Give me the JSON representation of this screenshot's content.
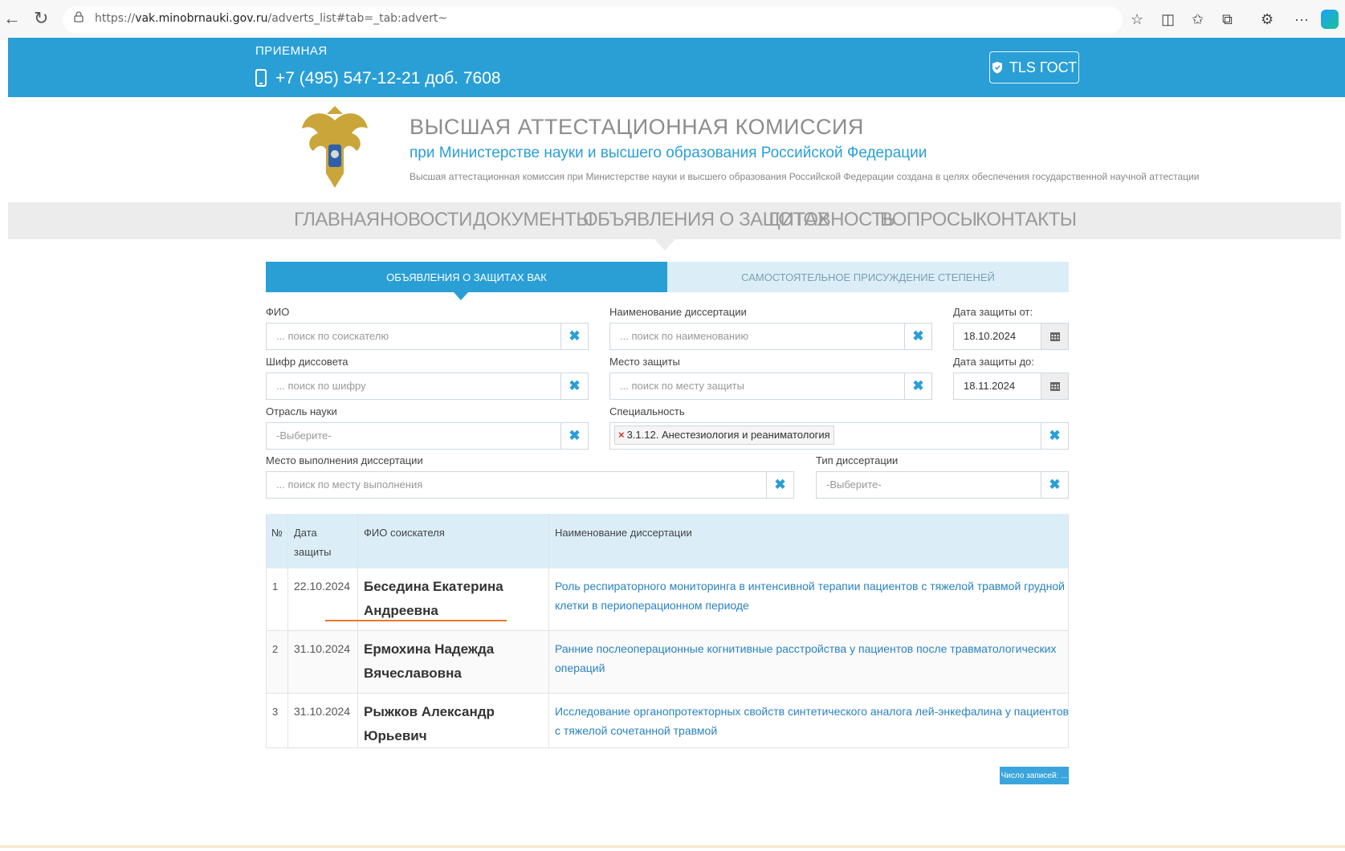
{
  "browser": {
    "back_icon": "back-arrow-icon",
    "reload_icon": "reload-icon",
    "url_prefix": "https://",
    "url_domain": "vak.minobrnauki.gov.ru",
    "url_path": "/adverts_list#tab=_tab:advert~",
    "more_label": "···"
  },
  "header": {
    "reception_label": "ПРИЕМНАЯ",
    "phone": "+7 (495) 547-12-21 доб. 7608",
    "tls_label": "TLS ГОСТ"
  },
  "org": {
    "title": "ВЫСШАЯ АТТЕСТАЦИОННАЯ КОМИССИЯ",
    "subtitle": "при Министерстве науки и высшего образования Российской Федерации",
    "description": "Высшая аттестационная комиссия при Министерстве науки и высшего образования Российской Федерации создана в целях обеспечения государственной научной аттестации"
  },
  "nav": {
    "items": [
      "ГЛАВНАЯ",
      "НОВОСТИ",
      "ДОКУМЕНТЫ",
      "ОБЪЯВЛЕНИЯ О ЗАЩИТАХ",
      "ГОТОВНОСТЬ",
      "ВОПРОСЫ",
      "КОНТАКТЫ"
    ]
  },
  "tabs": {
    "active": "ОБЪЯВЛЕНИЯ О ЗАЩИТАХ ВАК",
    "inactive": "САМОСТОЯТЕЛЬНОЕ ПРИСУЖДЕНИЕ СТЕПЕНЕЙ"
  },
  "form": {
    "fio_label": "ФИО",
    "fio_placeholder": "... поиск по соискателю",
    "title_label": "Наименование диссертации",
    "title_placeholder": "... поиск по наименованию",
    "date_from_label": "Дата защиты от:",
    "date_from_value": "18.10.2024",
    "council_label": "Шифр диссовета",
    "council_placeholder": "... поиск по шифру",
    "place_label": "Место защиты",
    "place_placeholder": "... поиск по месту защиты",
    "date_to_label": "Дата защиты до:",
    "date_to_value": "18.11.2024",
    "branch_label": "Отрасль науки",
    "branch_placeholder": "-Выберите-",
    "spec_label": "Специальность",
    "spec_tag": "3.1.12. Анестезиология и реаниматология",
    "exec_place_label": "Место выполнения диссертации",
    "exec_place_placeholder": "... поиск по месту выполнения",
    "type_label": "Тип диссертации",
    "type_placeholder": "-Выберите-",
    "clear_glyph": "✖"
  },
  "table": {
    "headers": {
      "num": "№",
      "date_line1": "Дата",
      "date_line2": "защиты",
      "fio": "ФИО соискателя",
      "title": "Наименование диссертации"
    },
    "rows": [
      {
        "num": "1",
        "date": "22.10.2024",
        "name_line1": "Беседина Екатерина",
        "name_line2": "Андреевна",
        "title": "Роль респираторного мониторинга в интенсивной терапии пациентов с тяжелой травмой грудной клетки в периоперационном периоде"
      },
      {
        "num": "2",
        "date": "31.10.2024",
        "name_line1": "Ермохина Надежда",
        "name_line2": "Вячеславовна",
        "title": "Ранние послеоперационные когнитивные расстройства у пациентов после травматологических операций"
      },
      {
        "num": "3",
        "date": "31.10.2024",
        "name_line1": "Рыжков Александр Юрьевич",
        "name_line2": "",
        "title": "Исследование органопротекторных свойств синтетического аналога лей-энкефалина у пациентов с тяжелой сочетанной травмой"
      }
    ]
  },
  "count_button_label": "Число записей: ...",
  "colors": {
    "brand_blue": "#2a9fd6",
    "light_blue": "#dbeef8",
    "link_blue": "#2a82c0",
    "underline_orange": "#e8772e"
  }
}
